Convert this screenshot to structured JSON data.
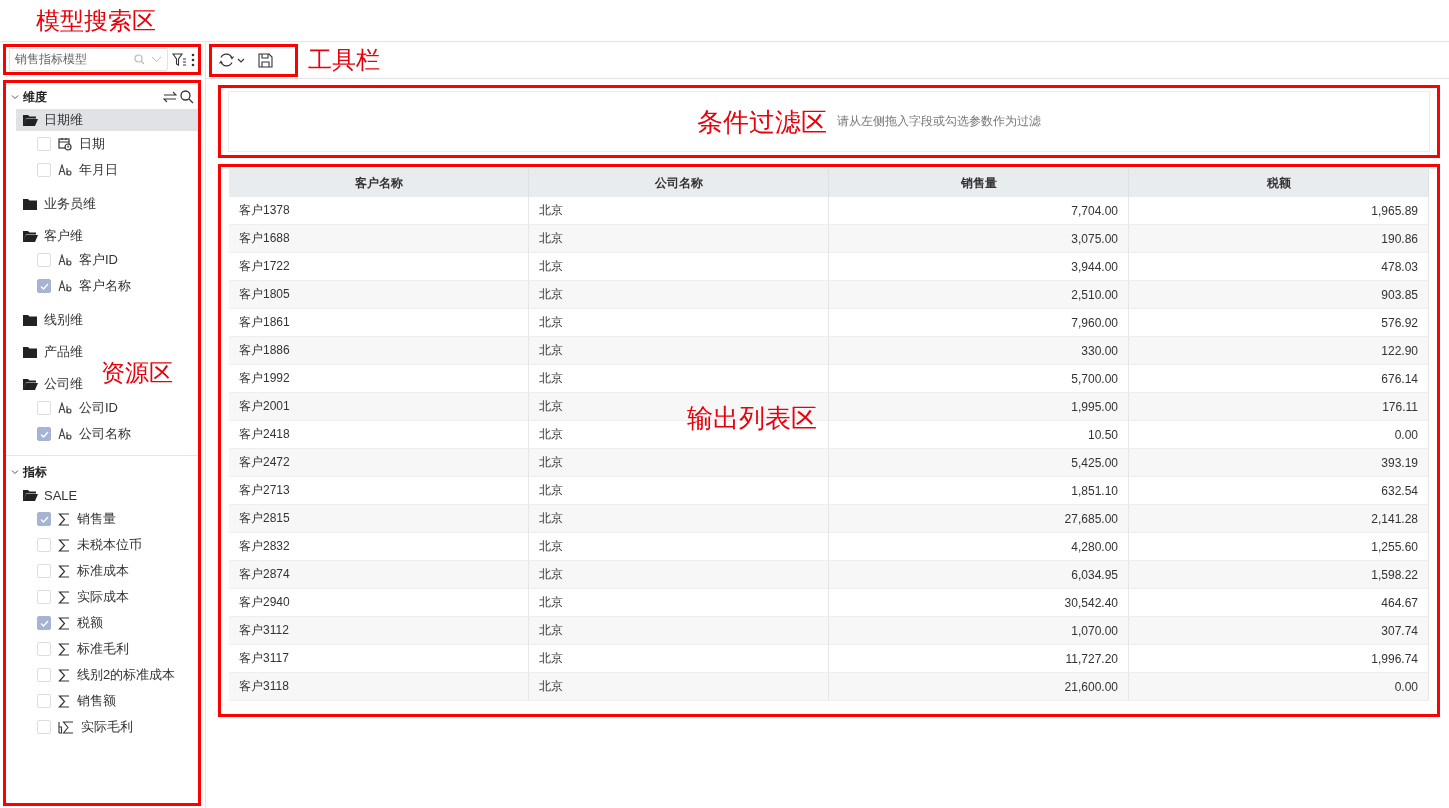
{
  "model_search": {
    "annotation": "模型搜索区",
    "value": "销售指标模型"
  },
  "toolbar": {
    "annotation": "工具栏"
  },
  "resources": {
    "annotation": "资源区",
    "sections": [
      {
        "title": "维度",
        "expanded": true,
        "folders": [
          {
            "label": "日期维",
            "expanded": true,
            "selected": true,
            "fields": [
              {
                "label": "日期",
                "kind": "date",
                "checked": false
              },
              {
                "label": "年月日",
                "kind": "text",
                "checked": false
              }
            ]
          },
          {
            "label": "业务员维",
            "expanded": false,
            "selected": false
          },
          {
            "label": "客户维",
            "expanded": true,
            "selected": false,
            "fields": [
              {
                "label": "客户ID",
                "kind": "text",
                "checked": false
              },
              {
                "label": "客户名称",
                "kind": "text",
                "checked": true
              }
            ]
          },
          {
            "label": "线别维",
            "expanded": false,
            "selected": false
          },
          {
            "label": "产品维",
            "expanded": false,
            "selected": false
          },
          {
            "label": "公司维",
            "expanded": true,
            "selected": false,
            "fields": [
              {
                "label": "公司ID",
                "kind": "text",
                "checked": false
              },
              {
                "label": "公司名称",
                "kind": "text",
                "checked": true
              }
            ]
          }
        ]
      },
      {
        "title": "指标",
        "expanded": true,
        "folders": [
          {
            "label": "SALE",
            "expanded": true,
            "selected": false,
            "fields": [
              {
                "label": "销售量",
                "kind": "measure",
                "checked": true
              },
              {
                "label": "未税本位币",
                "kind": "measure",
                "checked": false
              },
              {
                "label": "标准成本",
                "kind": "measure",
                "checked": false
              },
              {
                "label": "实际成本",
                "kind": "measure",
                "checked": false
              },
              {
                "label": "税额",
                "kind": "measure",
                "checked": true
              },
              {
                "label": "标准毛利",
                "kind": "measure",
                "checked": false
              },
              {
                "label": "线别2的标准成本",
                "kind": "measure",
                "checked": false
              },
              {
                "label": "销售额",
                "kind": "measure",
                "checked": false
              },
              {
                "label": "实际毛利",
                "kind": "calc",
                "checked": false
              }
            ]
          }
        ]
      }
    ]
  },
  "filter_area": {
    "annotation": "条件过滤区",
    "hint": "请从左侧拖入字段或勾选参数作为过滤"
  },
  "table": {
    "annotation": "输出列表区",
    "columns": [
      {
        "label": "客户名称",
        "kind": "text"
      },
      {
        "label": "公司名称",
        "kind": "text"
      },
      {
        "label": "销售量",
        "kind": "number"
      },
      {
        "label": "税额",
        "kind": "number"
      }
    ],
    "rows": [
      [
        "客户1378",
        "北京",
        "7,704.00",
        "1,965.89"
      ],
      [
        "客户1688",
        "北京",
        "3,075.00",
        "190.86"
      ],
      [
        "客户1722",
        "北京",
        "3,944.00",
        "478.03"
      ],
      [
        "客户1805",
        "北京",
        "2,510.00",
        "903.85"
      ],
      [
        "客户1861",
        "北京",
        "7,960.00",
        "576.92"
      ],
      [
        "客户1886",
        "北京",
        "330.00",
        "122.90"
      ],
      [
        "客户1992",
        "北京",
        "5,700.00",
        "676.14"
      ],
      [
        "客户2001",
        "北京",
        "1,995.00",
        "176.11"
      ],
      [
        "客户2418",
        "北京",
        "10.50",
        "0.00"
      ],
      [
        "客户2472",
        "北京",
        "5,425.00",
        "393.19"
      ],
      [
        "客户2713",
        "北京",
        "1,851.10",
        "632.54"
      ],
      [
        "客户2815",
        "北京",
        "27,685.00",
        "2,141.28"
      ],
      [
        "客户2832",
        "北京",
        "4,280.00",
        "1,255.60"
      ],
      [
        "客户2874",
        "北京",
        "6,034.95",
        "1,598.22"
      ],
      [
        "客户2940",
        "北京",
        "30,542.40",
        "464.67"
      ],
      [
        "客户3112",
        "北京",
        "1,070.00",
        "307.74"
      ],
      [
        "客户3117",
        "北京",
        "11,727.20",
        "1,996.74"
      ],
      [
        "客户3118",
        "北京",
        "21,600.00",
        "0.00"
      ]
    ]
  }
}
